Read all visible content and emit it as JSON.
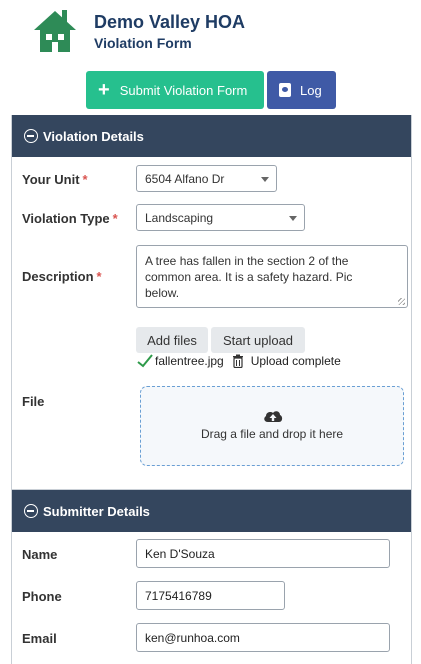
{
  "header": {
    "org_name": "Demo Valley HOA",
    "form_name": "Violation Form"
  },
  "toolbar": {
    "submit_label": "Submit Violation Form",
    "log_label": "Log"
  },
  "violation_section": {
    "title": "Violation Details",
    "unit": {
      "label": "Your Unit",
      "required": "*",
      "value": "6504 Alfano Dr"
    },
    "violation_type": {
      "label": "Violation Type",
      "required": "*",
      "value": "Landscaping"
    },
    "description": {
      "label": "Description",
      "required": "*",
      "lines": [
        "A tree has fallen in the section 2 of the",
        "common area. It is a safety hazard. Pic",
        "below."
      ]
    },
    "file": {
      "label": "File",
      "add_files_label": "Add files",
      "start_upload_label": "Start upload",
      "uploaded_file_name": "fallentree.jpg",
      "upload_status": "Upload complete",
      "dropzone_text": "Drag a file and drop it here"
    }
  },
  "submitter_section": {
    "title": "Submitter Details",
    "name": {
      "label": "Name",
      "value": "Ken D'Souza"
    },
    "phone": {
      "label": "Phone",
      "value": "7175416789"
    },
    "email": {
      "label": "Email",
      "value": "ken@runhoa.com"
    }
  },
  "colors": {
    "brand_navy": "#1f3c64",
    "submit_green": "#26c08e",
    "log_blue": "#3f5aa6",
    "panel_header": "#34465e",
    "required_red": "#d9534f",
    "logo_green": "#2e8b57"
  },
  "icons": {
    "logo": "house-logo-icon",
    "submit": "plus-icon",
    "log": "book-icon",
    "section_toggle": "minus-circle-icon",
    "dropdown": "caret-down-icon",
    "uploaded": "check-icon",
    "delete": "trash-icon",
    "upload": "cloud-upload-icon"
  }
}
